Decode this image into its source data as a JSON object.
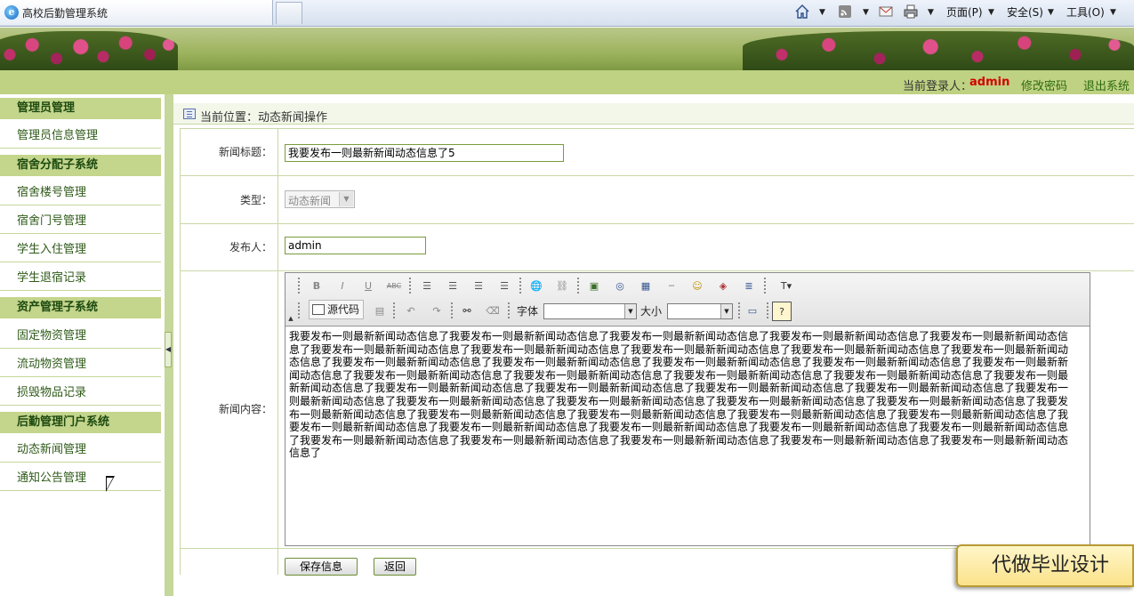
{
  "browser": {
    "tab_title": "高校后勤管理系统",
    "menu_page": "页面(P)",
    "menu_safety": "安全(S)",
    "menu_tools": "工具(O)"
  },
  "header": {
    "login_label": "当前登录人：",
    "user": "admin",
    "change_password": "修改密码",
    "logout": "退出系统"
  },
  "sidebar": {
    "sections": [
      {
        "title": "管理员管理",
        "items": [
          "管理员信息管理"
        ]
      },
      {
        "title": "宿舍分配子系统",
        "items": [
          "宿舍楼号管理",
          "宿舍门号管理",
          "学生入住管理",
          "学生退宿记录"
        ]
      },
      {
        "title": "资产管理子系统",
        "items": [
          "固定物资管理",
          "流动物资管理",
          "损毁物品记录"
        ]
      },
      {
        "title": "后勤管理门户系统",
        "items": [
          "动态新闻管理",
          "通知公告管理"
        ]
      }
    ]
  },
  "breadcrumb": "当前位置：动态新闻操作",
  "form": {
    "title_label": "新闻标题：",
    "title_value": "我要发布一则最新新闻动态信息了5",
    "type_label": "类型：",
    "type_value": "动态新闻",
    "author_label": "发布人：",
    "author_value": "admin",
    "content_label": "新闻内容：",
    "content_text": "我要发布一则最新新闻动态信息了我要发布一则最新新闻动态信息了我要发布一则最新新闻动态信息了我要发布一则最新新闻动态信息了我要发布一则最新新闻动态信息了我要发布一则最新新闻动态信息了我要发布一则最新新闻动态信息了我要发布一则最新新闻动态信息了我要发布一则最新新闻动态信息了我要发布一则最新新闻动态信息了我要发布一则最新新闻动态信息了我要发布一则最新新闻动态信息了我要发布一则最新新闻动态信息了我要发布一则最新新闻动态信息了我要发布一则最新新闻动态信息了我要发布一则最新新闻动态信息了我要发布一则最新新闻动态信息了我要发布一则最新新闻动态信息了我要发布一则最新新闻动态信息了我要发布一则最新新闻动态信息了我要发布一则最新新闻动态信息了我要发布一则最新新闻动态信息了我要发布一则最新新闻动态信息了我要发布一则最新新闻动态信息了我要发布一则最新新闻动态信息了我要发布一则最新新闻动态信息了我要发布一则最新新闻动态信息了我要发布一则最新新闻动态信息了我要发布一则最新新闻动态信息了我要发布一则最新新闻动态信息了我要发布一则最新新闻动态信息了我要发布一则最新新闻动态信息了我要发布一则最新新闻动态信息了我要发布一则最新新闻动态信息了我要发布一则最新新闻动态信息了我要发布一则最新新闻动态信息了我要发布一则最新新闻动态信息了我要发布一则最新新闻动态信息了我要发布一则最新新闻动态信息了我要发布一则最新新闻动态信息了我要发布一则最新新闻动态信息了我要发布一则最新新闻动态信息了我要发布一则最新新闻动态信息了我要发布一则最新新闻动态信息了",
    "save_label": "保存信息",
    "back_label": "返回"
  },
  "editor": {
    "source_label": "源代码",
    "font_label": "字体",
    "size_label": "大小"
  },
  "promo": "代做毕业设计"
}
